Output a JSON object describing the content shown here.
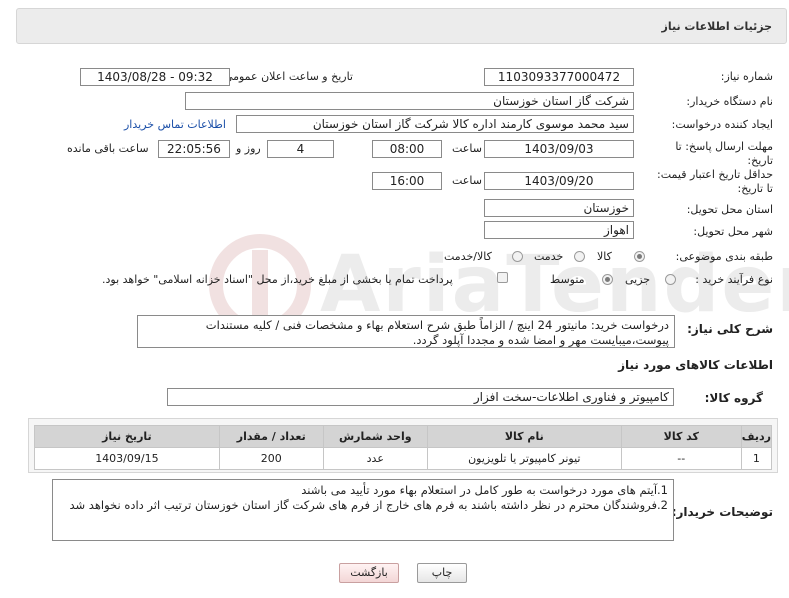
{
  "header": {
    "title": "جزئیات اطلاعات نیاز"
  },
  "fields": {
    "need_number_label": "شماره نیاز:",
    "need_number": "1103093377000472",
    "announce_label": "تاریخ و ساعت اعلان عمومی:",
    "announce_value": "1403/08/28 - 09:32",
    "buyer_org_label": "نام دستگاه خریدار:",
    "buyer_org": "شرکت گاز استان خوزستان",
    "creator_label": "ایجاد کننده درخواست:",
    "creator": "سید محمد موسوی کارمند اداره کالا شرکت گاز استان خوزستان",
    "contact_link": "اطلاعات تماس خریدار",
    "deadline_label": "مهلت ارسال پاسخ: تا تاریخ:",
    "deadline_date": "1403/09/03",
    "time_label": "ساعت",
    "deadline_time": "08:00",
    "days_value": "4",
    "days_and": "روز و",
    "remaining_time": "22:05:56",
    "remaining_label": "ساعت باقی مانده",
    "validity_label": "حداقل تاریخ اعتبار قیمت: تا تاریخ:",
    "validity_date": "1403/09/20",
    "validity_time": "16:00",
    "province_label": "استان محل تحویل:",
    "province": "خوزستان",
    "city_label": "شهر محل تحویل:",
    "city": "اهواز",
    "category_label": "طبقه بندی موضوعی:",
    "category_options": [
      "کالا",
      "خدمت",
      "کالا/خدمت"
    ],
    "process_label": "نوع فرآیند خرید :",
    "process_options": [
      "جزیی",
      "متوسط"
    ],
    "payment_note": "پرداخت تمام یا بخشی از مبلغ خرید،از محل \"اسناد خزانه اسلامی\" خواهد بود."
  },
  "summary": {
    "label": "شرح کلی نیاز:",
    "line1": "درخواست خرید: مانیتور 24 اینچ / الزاماً طبق شرح استعلام بهاء و مشخصات فنی / کلیه مستندات",
    "line2": "پیوست،میبایست مهر و امضا شده و مجددا آپلود گردد."
  },
  "goods": {
    "section_title": "اطلاعات کالاهای مورد نیاز",
    "group_label": "گروه کالا:",
    "group_value": "کامپیوتر و فناوری اطلاعات-سخت افزار",
    "columns": [
      "ردیف",
      "کد کالا",
      "نام کالا",
      "واحد شمارش",
      "تعداد / مقدار",
      "تاریخ نیاز"
    ],
    "rows": [
      [
        "1",
        "--",
        "تیونر کامپیوتر یا تلویزیون",
        "عدد",
        "200",
        "1403/09/15"
      ]
    ]
  },
  "buyer_notes": {
    "label": "توضیحات خریدار:",
    "line1": "1.آیتم های مورد درخواست به طور کامل در استعلام بهاء مورد تأیید می باشند",
    "line2": "2.فروشندگان محترم در نظر داشته باشند به فرم های خارج از فرم های شرکت گاز استان خوزستان ترتیب اثر داده نخواهد شد"
  },
  "buttons": {
    "print": "چاپ",
    "back": "بازگشت"
  },
  "watermark": {
    "text": "AriaTender.neT"
  }
}
